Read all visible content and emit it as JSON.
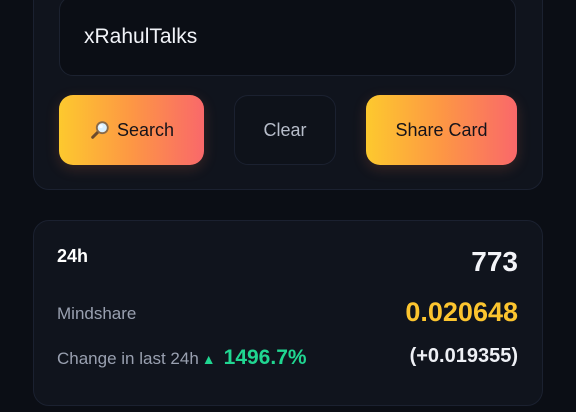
{
  "search": {
    "value": "xRahulTalks",
    "search_label": "Search",
    "clear_label": "Clear",
    "share_label": "Share Card",
    "search_icon": "magnifier-icon"
  },
  "stats": {
    "period": "24h",
    "rank": "773",
    "mindshare_label": "Mindshare",
    "mindshare_value": "0.020648",
    "change_label": "Change in last 24h",
    "change_arrow": "▲",
    "change_percent": "1496.7%",
    "change_absolute": "(+0.019355)"
  },
  "colors": {
    "background": "#0b0e15",
    "card": "#10141d",
    "accent_yellow": "#fcc52f",
    "accent_green": "#20d691",
    "gradient_start": "#fdc92e",
    "gradient_end": "#f9686a"
  }
}
